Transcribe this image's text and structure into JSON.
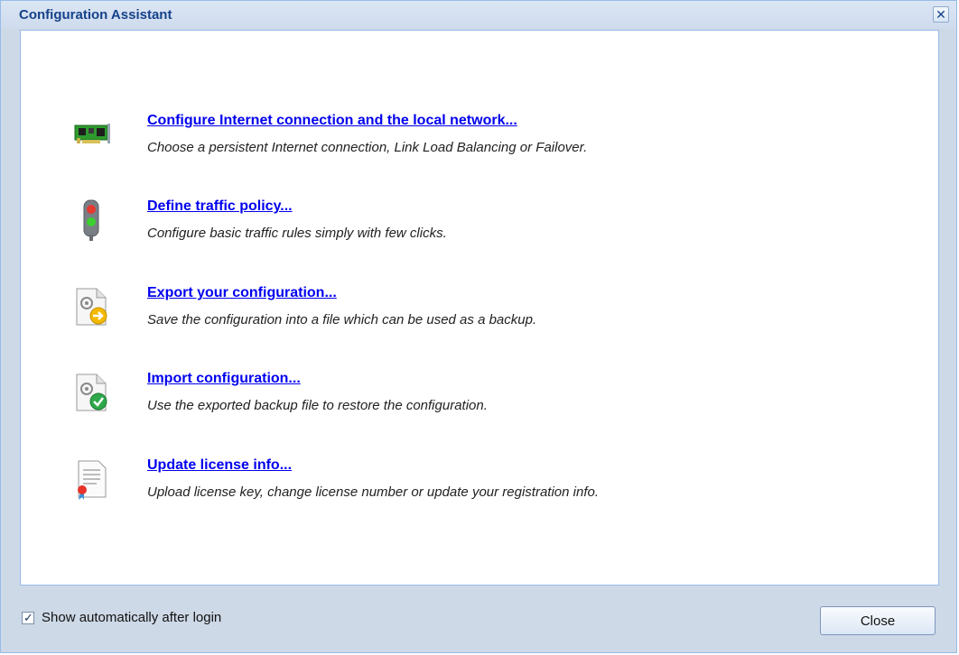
{
  "dialog": {
    "title": "Configuration Assistant",
    "close_icon": "close-icon"
  },
  "items": [
    {
      "icon": "network-card-icon",
      "link": "Configure Internet connection and the local network...",
      "description": "Choose a persistent Internet connection, Link Load Balancing or Failover."
    },
    {
      "icon": "traffic-light-icon",
      "link": "Define traffic policy...",
      "description": "Configure basic traffic rules simply with few clicks."
    },
    {
      "icon": "export-config-icon",
      "link": "Export your configuration...",
      "description": "Save the configuration into a file which can be used as a backup."
    },
    {
      "icon": "import-config-icon",
      "link": "Import configuration...",
      "description": "Use the exported backup file to restore the configuration."
    },
    {
      "icon": "license-certificate-icon",
      "link": "Update license info...",
      "description": "Upload license key, change license number or update your registration info."
    }
  ],
  "footer": {
    "show_auto_label": "Show automatically after login",
    "show_auto_checked": true,
    "close_label": "Close"
  },
  "colors": {
    "link": "#0000ee",
    "title": "#15428b",
    "frame": "#ced9e7",
    "border": "#99bbe8"
  }
}
